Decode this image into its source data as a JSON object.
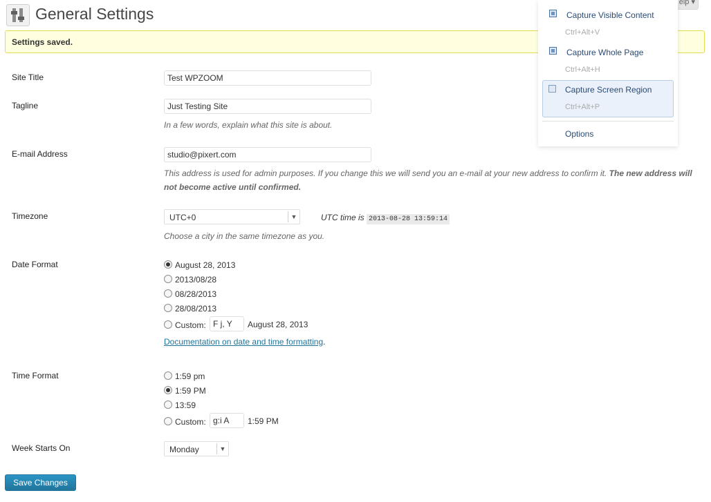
{
  "page": {
    "title": "General Settings",
    "help_label": "elp",
    "notice": "Settings saved."
  },
  "fields": {
    "site_title": {
      "label": "Site Title",
      "value": "Test WPZOOM"
    },
    "tagline": {
      "label": "Tagline",
      "value": "Just Testing Site",
      "description": "In a few words, explain what this site is about."
    },
    "email": {
      "label": "E-mail Address",
      "value": "studio@pixert.com",
      "description_line1": "This address is used for admin purposes. If you change this we will send you an e-mail at your new address to confirm it.",
      "description_bold1": "The new address will",
      "description_bold2": "not become active until confirmed."
    },
    "timezone": {
      "label": "Timezone",
      "value": "UTC+0",
      "utc_label": "UTC time is",
      "utc_time": "2013-08-28 13:59:14",
      "description": "Choose a city in the same timezone as you."
    },
    "date_format": {
      "label": "Date Format",
      "options": [
        "August 28, 2013",
        "2013/08/28",
        "08/28/2013",
        "28/08/2013"
      ],
      "selected": 0,
      "custom_label": "Custom:",
      "custom_value": "F j, Y",
      "custom_preview": "August 28, 2013",
      "doc_link": "Documentation on date and time formatting",
      "doc_link_suffix": "."
    },
    "time_format": {
      "label": "Time Format",
      "options": [
        "1:59 pm",
        "1:59 PM",
        "13:59"
      ],
      "selected": 1,
      "custom_label": "Custom:",
      "custom_value": "g:i A",
      "custom_preview": "1:59 PM"
    },
    "week_start": {
      "label": "Week Starts On",
      "value": "Monday"
    }
  },
  "save_button": "Save Changes",
  "capture_menu": {
    "items": [
      {
        "label": "Capture Visible Content",
        "shortcut": "Ctrl+Alt+V",
        "checked": true
      },
      {
        "label": "Capture Whole Page",
        "shortcut": "Ctrl+Alt+H",
        "checked": true
      },
      {
        "label": "Capture Screen Region",
        "shortcut": "Ctrl+Alt+P",
        "checked": false
      }
    ],
    "options_label": "Options"
  },
  "colors": {
    "notice_bg": "#ffffe0",
    "notice_border": "#e6db55",
    "primary_button": "#21759b",
    "link": "#21759b"
  }
}
